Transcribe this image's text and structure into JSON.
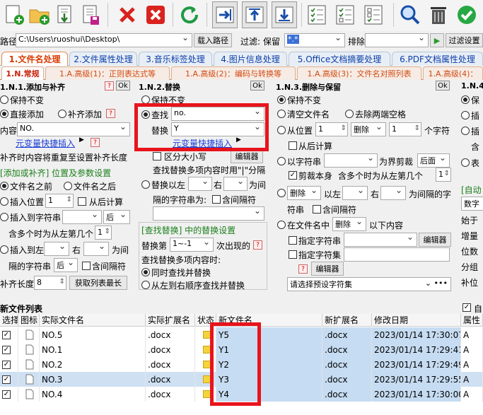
{
  "toolbar": {
    "icons": [
      "add-files-icon",
      "add-folder-icon",
      "import-icon",
      "save-icon",
      "delete-icon",
      "clear-icon",
      "refresh-icon",
      "move-right-icon",
      "move-up-icon",
      "move-down-icon",
      "checklist-icon",
      "search-icon",
      "trash-icon",
      "confirm-icon"
    ]
  },
  "path": {
    "label": "路径",
    "value": "C:\\Users\\ruoshui\\Desktop\\",
    "load_button": "载入路径",
    "filter_label": "过滤:",
    "filter_keep": "保留",
    "filter_keep_value": "*.*",
    "exclude_label": "排除",
    "exclude_value": "",
    "filter_settings_button": "过滤设置"
  },
  "main_tabs": [
    "1.文件名处理",
    "2.文件属性处理",
    "3.音乐标签处理",
    "4.图片信息处理",
    "5.Office文档摘要处理",
    "6.PDF文档属性处理"
  ],
  "sub_tabs": [
    "1.N.常规",
    "1.A.高级(1)：正则表达式等",
    "1.A.高级(2)：编码与转换等",
    "1.A.高级(3)：文件名对照列表",
    "1.A.高级(4)："
  ],
  "panel1": {
    "title": "1.N.1.添加与补齐",
    "ok": "Ok",
    "keep": "保持不变",
    "direct_add": "直接添加",
    "pad_add": "补齐添加",
    "content_label": "内容",
    "content_value": "NO.",
    "quick_insert": "元变量快捷插入",
    "pad_note": "补齐时内容将重复至设置补齐长度",
    "section": "[添加或补齐] 位置及参数设置",
    "before_name": "文件名之前",
    "after_name": "文件名之后",
    "insert_pos": "插入位置",
    "insert_pos_value": "1",
    "calc_from_end": "从后计算",
    "insert_to_str": "插入到字符串",
    "after_value": "后",
    "multi_note": "含多个时为从左第几个",
    "multi_value": "1",
    "insert_between": "插入到左",
    "right": "右",
    "between": "为间",
    "sep_str": "隔的字符串",
    "sep_after": "后",
    "include_sep": "含间隔符",
    "pad_len": "补齐长度",
    "pad_len_value": "8",
    "get_max": "获取列表最长"
  },
  "panel2": {
    "title": "1.N.2.替换",
    "ok": "Ok",
    "keep": "保持不变",
    "find": "查找",
    "find_value": "no.",
    "replace": "替换",
    "replace_value": "Y",
    "quick_insert": "元变量快捷插入",
    "case": "区分大小写",
    "editor": "编辑器",
    "multi_note": "查找替换多项内容时用\"|\"分隔",
    "replace_between": "替换以左",
    "right": "右",
    "between": "为间",
    "sep_str": "隔的字符串为:",
    "include_sep": "含间隔符",
    "section": "[查找替换] 中的替换设置",
    "replace_nth": "替换第",
    "nth_value": "1~-1",
    "occurrence": "次出现的",
    "multi_mode": "查找替换多项内容时:",
    "simultaneous": "同时查找并替换",
    "sequential": "从左到右顺序查找并替换"
  },
  "panel3": {
    "title": "1.N.3.删除与保留",
    "ok": "Ok",
    "keep": "保持不变",
    "clear_name": "清空文件名",
    "trim_spaces": "去除两端空格",
    "from_pos": "从位置",
    "from_pos_value": "1",
    "delete_value": "删除",
    "count_value": "1",
    "chars": "个字符",
    "calc_from_end": "从后计算",
    "by_str": "以字符串",
    "as_boundary": "为界剪裁",
    "after_value": "后面",
    "cut_self": "剪裁本身",
    "multi_note": "含多个时为从左第几个",
    "multi_value": "1",
    "delete2": "删除",
    "left": "以左",
    "right": "右",
    "between_str": "为间隔的字",
    "str": "符串",
    "include_sep": "含间隔符",
    "in_name": "在文件名中",
    "delete3": "删除",
    "below": "以下内容",
    "specify_set": "指定字符串",
    "editor": "编辑器",
    "specify_set2": "指定字符集",
    "editor2": "编辑器",
    "preset": "请选择预设字符集"
  },
  "panel4": {
    "title": "1.N.4.",
    "keep": "保",
    "insert": "插",
    "insert2": "插",
    "contain": "含",
    "table": "表",
    "section": "[自动",
    "digits": "数字",
    "start": "始于",
    "inc": "增量",
    "width": "位数",
    "group": "分组",
    "pad": "补位"
  },
  "grid": {
    "title": "新文件列表",
    "auto_label": "自",
    "columns": [
      "选择",
      "图标",
      "实际文件名",
      "实际扩展名",
      "状态",
      "新文件名",
      "新扩展名",
      "修改日期",
      "属性"
    ],
    "rows": [
      {
        "name": "NO.5",
        "ext": ".docx",
        "new": "Y5",
        "newext": ".docx",
        "date": "2023/01/14 17:30:07",
        "attr": "A"
      },
      {
        "name": "NO.1",
        "ext": ".docx",
        "new": "Y1",
        "newext": ".docx",
        "date": "2023/01/14 17:29:41",
        "attr": "A"
      },
      {
        "name": "NO.2",
        "ext": ".docx",
        "new": "Y2",
        "newext": ".docx",
        "date": "2023/01/14 17:29:49",
        "attr": "A"
      },
      {
        "name": "NO.3",
        "ext": ".docx",
        "new": "Y3",
        "newext": ".docx",
        "date": "2023/01/14 17:29:55",
        "attr": "A"
      },
      {
        "name": "NO.4",
        "ext": ".docx",
        "new": "Y4",
        "newext": ".docx",
        "date": "2023/01/14 17:30:00",
        "attr": "A"
      }
    ]
  },
  "colors": {
    "accent_red": "#e8141c",
    "tab_orange": "#d83a00",
    "link_blue": "#1a3fd8",
    "section_green": "#1a7f1a",
    "row_highlight": "#c6dcf2"
  }
}
